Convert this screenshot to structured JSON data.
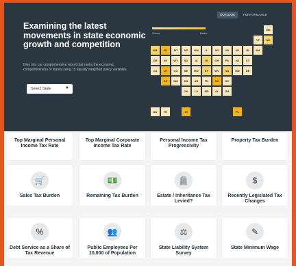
{
  "hero": {
    "title": "Examining the latest movements in state economic growth and competition",
    "description": "Dive into our comprehensive report that ranks the economic competitiveness of states using 15 equally weighted policy variables.",
    "select_placeholder": "Select State",
    "toggle_on": "OUTLOOK",
    "toggle_off": "PERFORMANCE",
    "legend_low": "Worse",
    "legend_high": "Better"
  },
  "colors": {
    "frame": "#e8541e",
    "hero_bg": "#2b3740",
    "light": "#f6e7bf",
    "mid": "#f5d36b",
    "dark": "#f2b41d"
  },
  "states": [
    {
      "code": "ME",
      "shade": "light"
    },
    {
      "code": "VT",
      "shade": "light"
    },
    {
      "code": "NH",
      "shade": "mid"
    },
    {
      "code": "WA",
      "shade": "mid"
    },
    {
      "code": "ID",
      "shade": "dark"
    },
    {
      "code": "MT",
      "shade": "light"
    },
    {
      "code": "ND",
      "shade": "light"
    },
    {
      "code": "MN",
      "shade": "light"
    },
    {
      "code": "IL",
      "shade": "light"
    },
    {
      "code": "WI",
      "shade": "light"
    },
    {
      "code": "MI",
      "shade": "light"
    },
    {
      "code": "NY",
      "shade": "light"
    },
    {
      "code": "RI",
      "shade": "light"
    },
    {
      "code": "MA",
      "shade": "light"
    },
    {
      "code": "OR",
      "shade": "light"
    },
    {
      "code": "NV",
      "shade": "light"
    },
    {
      "code": "WY",
      "shade": "light"
    },
    {
      "code": "SD",
      "shade": "light"
    },
    {
      "code": "IA",
      "shade": "light"
    },
    {
      "code": "IN",
      "shade": "mid"
    },
    {
      "code": "OH",
      "shade": "light"
    },
    {
      "code": "PA",
      "shade": "light"
    },
    {
      "code": "NJ",
      "shade": "light"
    },
    {
      "code": "CT",
      "shade": "light"
    },
    {
      "code": "CA",
      "shade": "light"
    },
    {
      "code": "UT",
      "shade": "dark"
    },
    {
      "code": "CO",
      "shade": "light"
    },
    {
      "code": "NE",
      "shade": "light"
    },
    {
      "code": "MO",
      "shade": "light"
    },
    {
      "code": "KY",
      "shade": "mid"
    },
    {
      "code": "WV",
      "shade": "light"
    },
    {
      "code": "VA",
      "shade": "mid"
    },
    {
      "code": "MD",
      "shade": "light"
    },
    {
      "code": "DE",
      "shade": "light"
    },
    {
      "code": "AZ",
      "shade": "dark"
    },
    {
      "code": "NM",
      "shade": "light"
    },
    {
      "code": "KS",
      "shade": "light"
    },
    {
      "code": "AR",
      "shade": "light"
    },
    {
      "code": "TN",
      "shade": "light"
    },
    {
      "code": "NC",
      "shade": "dark"
    },
    {
      "code": "SC",
      "shade": "light"
    },
    {
      "code": "OK",
      "shade": "light"
    },
    {
      "code": "LA",
      "shade": "light"
    },
    {
      "code": "MS",
      "shade": "light"
    },
    {
      "code": "AL",
      "shade": "light"
    },
    {
      "code": "GA",
      "shade": "light"
    },
    {
      "code": "AK",
      "shade": "light"
    },
    {
      "code": "HI",
      "shade": "light"
    },
    {
      "code": "TX",
      "shade": "dark"
    },
    {
      "code": "FL",
      "shade": "dark"
    }
  ],
  "cards": [
    {
      "label": "Top Marginal Personal Income Tax Rate",
      "icon": "",
      "icon_name": "none"
    },
    {
      "label": "Top Marginal Corporate Income Tax Rate",
      "icon": "",
      "icon_name": "none"
    },
    {
      "label": "Personal Income Tax Progressivity",
      "icon": "",
      "icon_name": "none"
    },
    {
      "label": "Property Tax Burden",
      "icon": "",
      "icon_name": "none"
    },
    {
      "label": "Sales Tax Burden",
      "icon": "🛒",
      "icon_name": "shopping-cart-icon"
    },
    {
      "label": "Remaining Tax Burden",
      "icon": "💵",
      "icon_name": "cash-icon"
    },
    {
      "label": "Estate / Inheritance Tax Levied?",
      "icon": "🪦",
      "icon_name": "tombstone-icon"
    },
    {
      "label": "Recently Legislated Tax Changes",
      "icon": "$",
      "icon_name": "dollar-refresh-icon"
    },
    {
      "label": "Debt Service as a Share of Tax Revenue",
      "icon": "%",
      "icon_name": "percent-icon"
    },
    {
      "label": "Public Employees Per 10,000 of Population",
      "icon": "👥",
      "icon_name": "people-icon"
    },
    {
      "label": "State Liability System Survey",
      "icon": "⚖",
      "icon_name": "scales-icon"
    },
    {
      "label": "State Minimum Wage",
      "icon": "✎",
      "icon_name": "wage-icon"
    }
  ]
}
